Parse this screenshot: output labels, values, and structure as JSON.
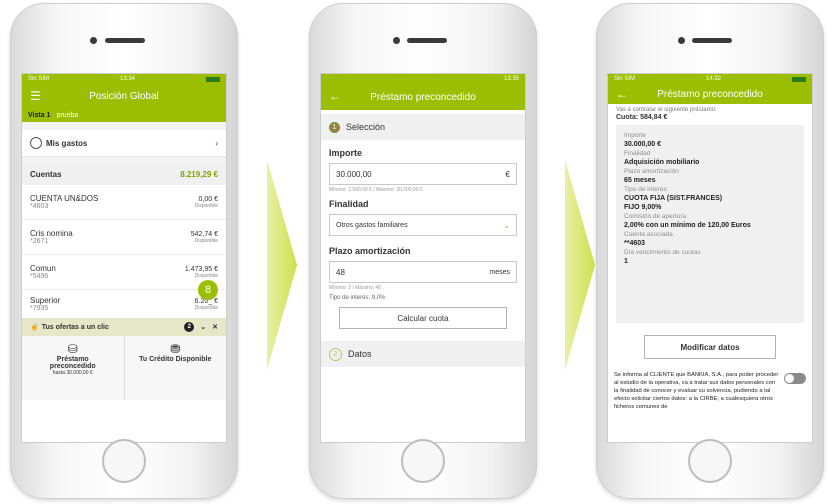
{
  "phone1": {
    "status": {
      "carrier": "Sin SIM",
      "time": "13:34"
    },
    "title": "Posición Global",
    "tabs": [
      "Vista 1",
      "prueba"
    ],
    "mis_gastos": "Mis gastos",
    "cuentas": {
      "label": "Cuentas",
      "total": "8.219,29 €"
    },
    "accounts": [
      {
        "name": "CUENTA UN&DOS",
        "num": "*4603",
        "amount": "0,00 €",
        "sub": "Disponible"
      },
      {
        "name": "Cris nomina",
        "num": "*2671",
        "amount": "542,74 €",
        "sub": "Disponible"
      },
      {
        "name": "Comun",
        "num": "*5496",
        "amount": "1.473,95 €",
        "sub": "Disponible"
      },
      {
        "name": "Superior",
        "num": "*7935",
        "amount": "6.20_ €",
        "sub": "Disponible"
      }
    ],
    "fab_label": "8",
    "ofertas": {
      "title": "Tus ofertas a un clic",
      "badge": "2"
    },
    "offer1": {
      "line1": "Préstamo",
      "line2": "preconcedido",
      "line3": "hasta 30.000,00 €"
    },
    "offer2": {
      "label": "Tu Crédito Disponible"
    }
  },
  "phone2": {
    "title": "Préstamo preconcedido",
    "status_time": "13:35",
    "seleccion": "Selección",
    "step1": "1",
    "importe": {
      "label": "Importe",
      "value": "30.000,00",
      "unit": "€",
      "hint": "Mínimo: 3.000,00 € / Máximo: 30.000,00 €"
    },
    "finalidad": {
      "label": "Finalidad",
      "value": "Otros gastos familiares"
    },
    "plazo": {
      "label": "Plazo amortización",
      "value": "48",
      "unit": "meses",
      "hint": "Mínimo: 3 / Máximo: 48"
    },
    "tipo": "Tipo de interés: 9,0%",
    "calcular": "Calcular cuota",
    "datos": "Datos",
    "step2": "2"
  },
  "phone3": {
    "status": {
      "carrier": "Sin SIM",
      "time": "14:32"
    },
    "title": "Préstamo preconcedido",
    "intro": "Vas a contratar el siguiente préstamo:",
    "cuota": "Cuota: 584,84 €",
    "details": [
      {
        "k": "Importe",
        "v": "30.000,00 €"
      },
      {
        "k": "Finalidad",
        "v": "Adquisición mobiliario"
      },
      {
        "k": "Plazo amortización",
        "v": "65 meses"
      },
      {
        "k": "Tipo de interés",
        "v": "CUOTA FIJA (SIST.FRANCES)"
      },
      {
        "k": "",
        "v": "FIJO 9,00%"
      },
      {
        "k": "Comisión de apertura",
        "v": "2,00% con un mínimo de 120,00 Euros"
      },
      {
        "k": "Cuenta asociada",
        "v": "**4603"
      },
      {
        "k": "Día vencimiento de cuotas",
        "v": "1"
      }
    ],
    "modificar": "Modificar datos",
    "legal": "Se informa al CLIENTE que BANKIA, S.A., para poder proceder al estudio de la operativa, va a tratar sus datos personales con la finalidad de conocer y evaluar su solvencia, pudiendo a tal efecto solicitar ciertos datos: a la CIRBE, a cualesquiera otros ficheros comunes de"
  },
  "colors": {
    "accent": "#9bbf00",
    "arrow": "#cde04e"
  }
}
